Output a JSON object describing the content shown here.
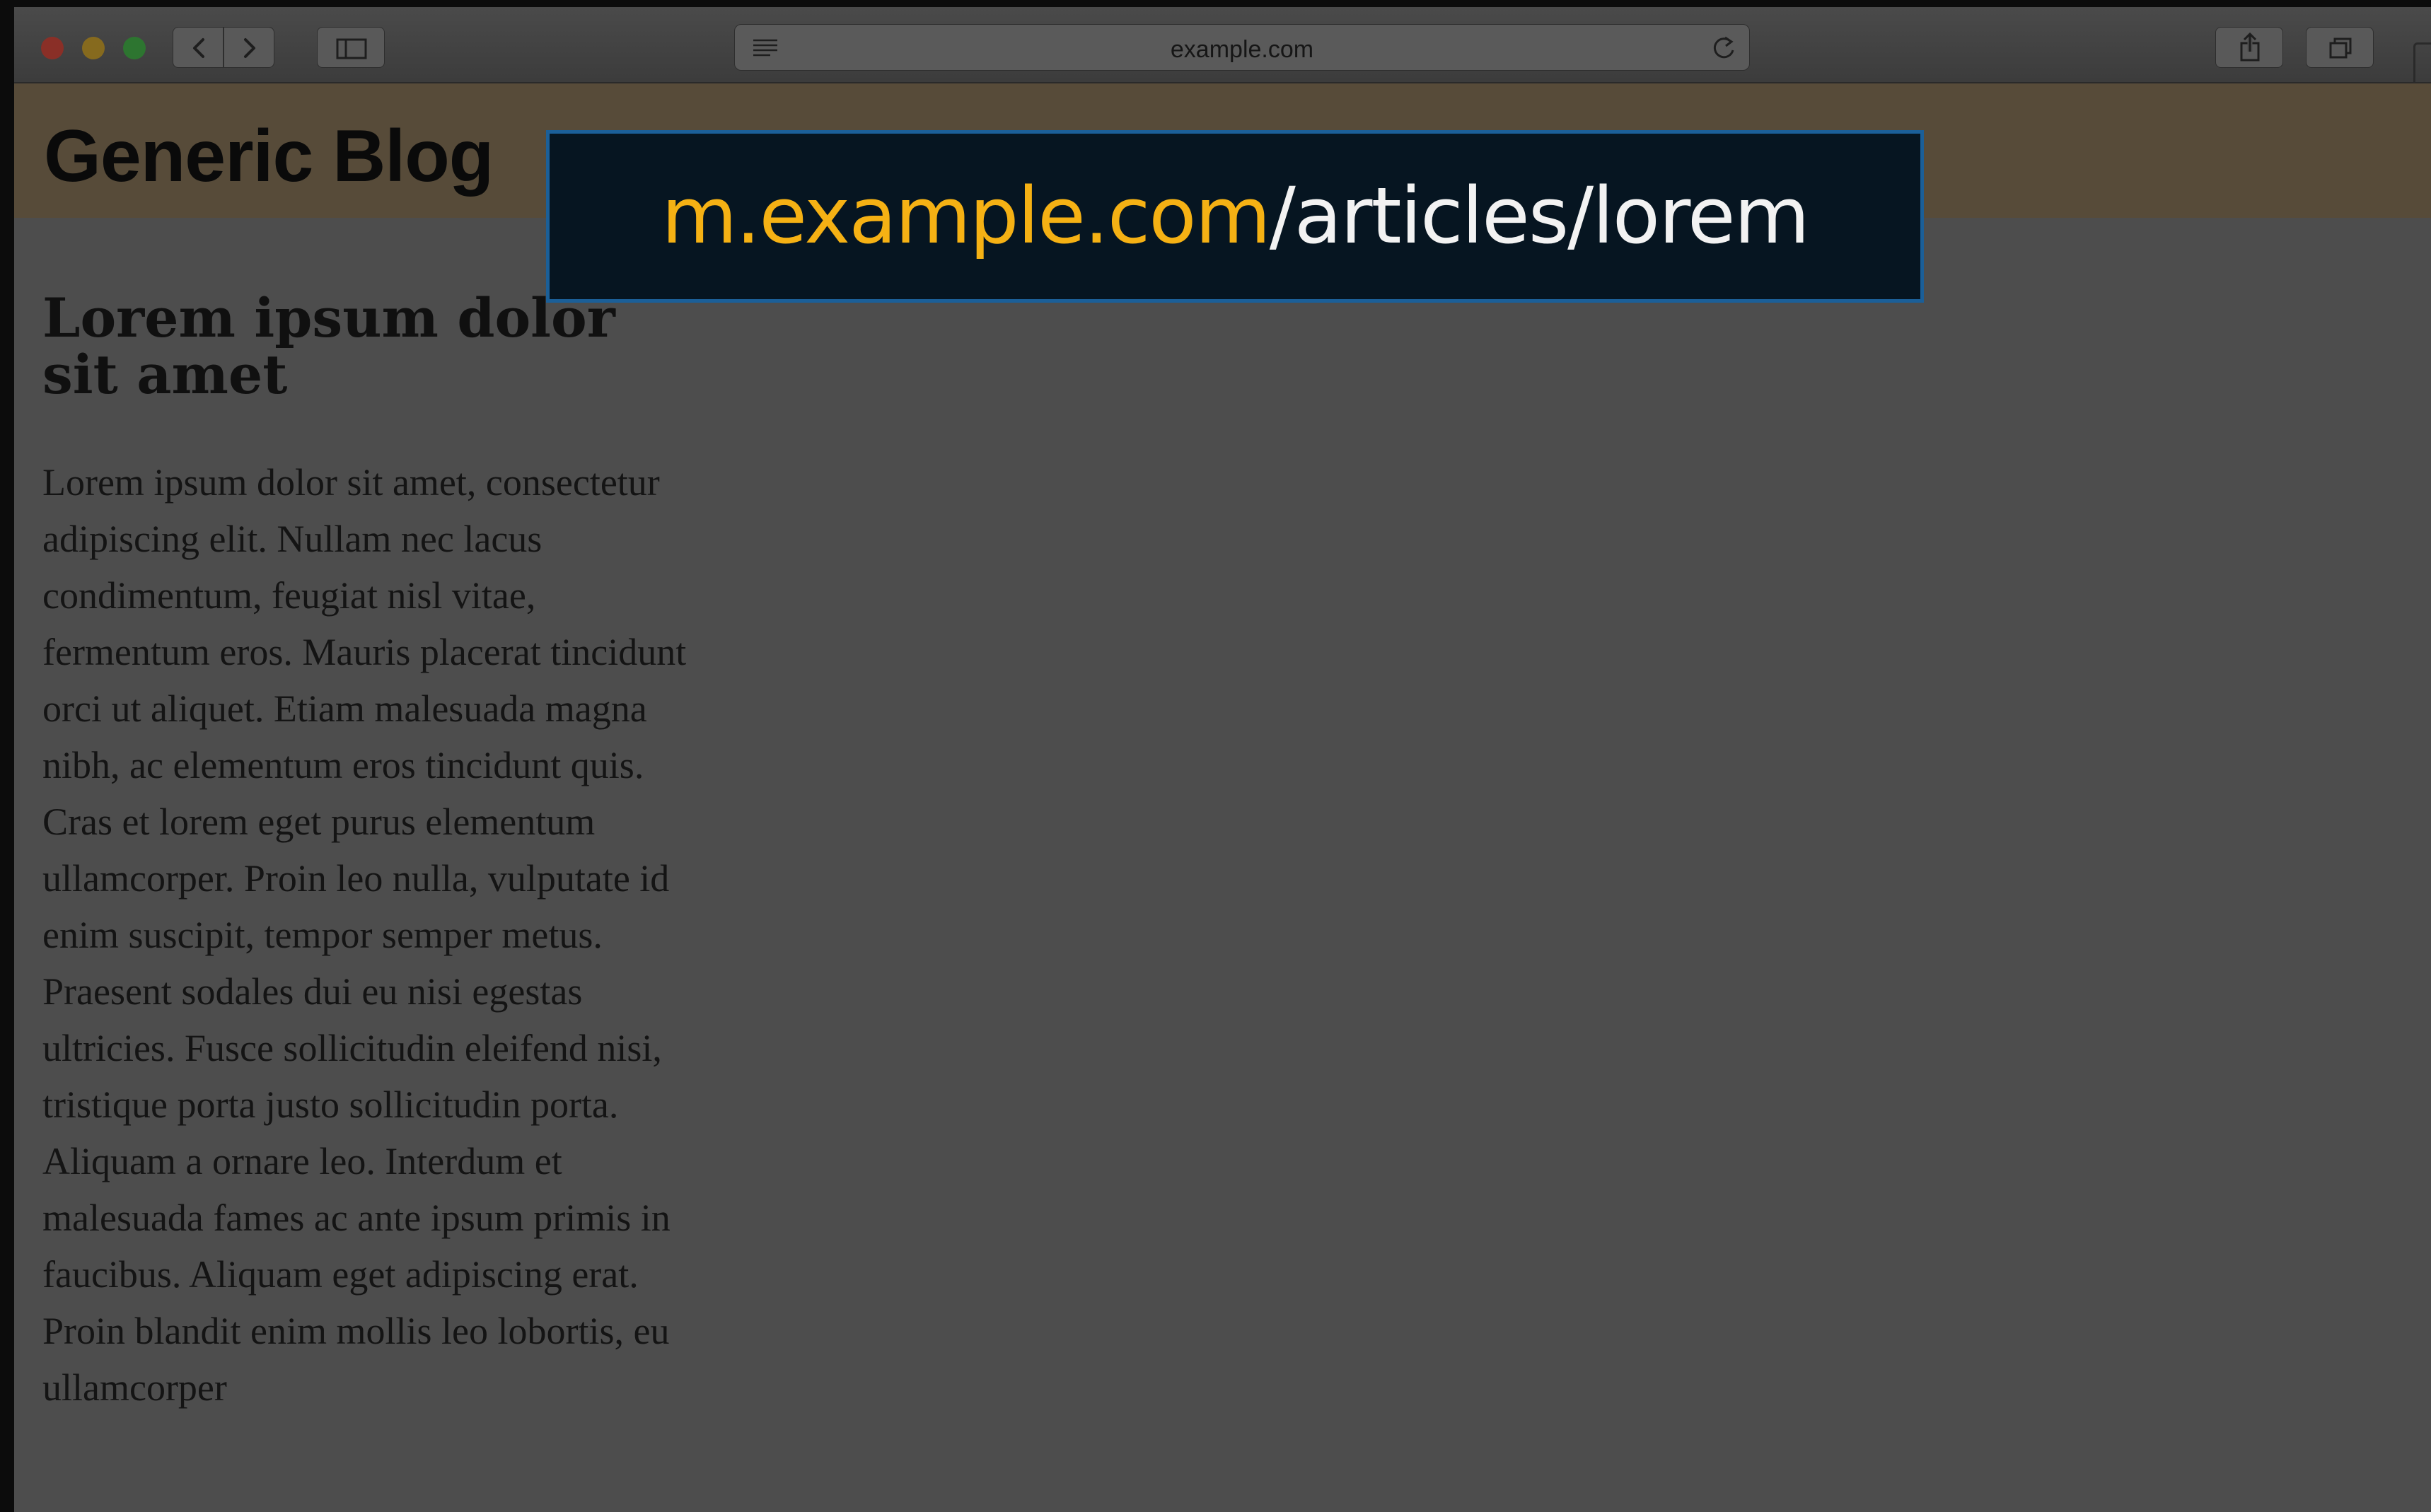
{
  "browser": {
    "address_bar": {
      "url": "example.com"
    }
  },
  "site": {
    "title": "Generic Blog"
  },
  "article": {
    "title": "Lorem ipsum dolor sit amet",
    "body": "Lorem ipsum dolor sit amet, consectetur adipiscing elit. Nullam nec lacus condimentum, feugiat nisl vitae, fermentum eros. Mauris placerat tincidunt orci ut aliquet. Etiam malesuada magna nibh, ac elementum eros tincidunt quis. Cras et lorem eget purus elementum ullamcorper. Proin leo nulla, vulputate id enim suscipit, tempor semper metus. Praesent sodales dui eu nisi egestas ultricies. Fusce sollicitudin eleifend nisi, tristique porta justo sollicitudin porta. Aliquam a ornare leo. Interdum et malesuada fames ac ante ipsum primis in faucibus. Aliquam eget adipiscing erat. Proin blandit enim mollis leo lobortis, eu ullamcorper"
  },
  "overlay": {
    "host": "m.example.com",
    "path": "/articles/lorem"
  },
  "colors": {
    "host_accent": "#f5b114",
    "banner_bg": "#061521",
    "banner_border": "#1b5f98"
  }
}
